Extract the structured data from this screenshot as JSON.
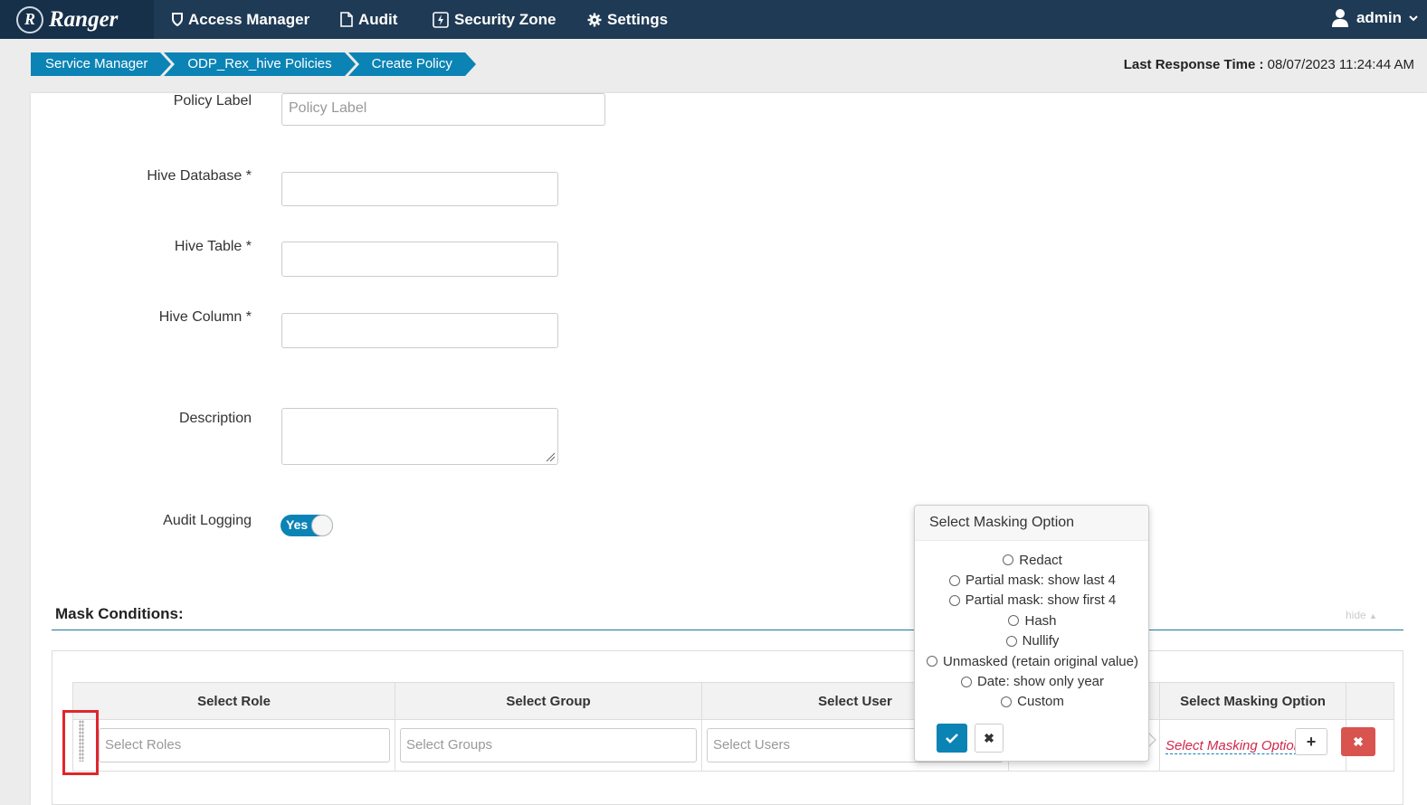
{
  "nav": {
    "brand": "Ranger",
    "brand_initial": "R",
    "access_manager": "Access Manager",
    "audit": "Audit",
    "security_zone": "Security Zone",
    "settings": "Settings",
    "user": "admin"
  },
  "breadcrumb": [
    "Service Manager",
    "ODP_Rex_hive Policies",
    "Create Policy"
  ],
  "last_response": {
    "label": "Last Response Time :",
    "value": "08/07/2023 11:24:44 AM"
  },
  "form": {
    "policy_label": {
      "label": "Policy Label",
      "placeholder": "Policy Label"
    },
    "hive_database": {
      "label": "Hive Database *",
      "value": ""
    },
    "hive_table": {
      "label": "Hive Table *",
      "value": ""
    },
    "hive_column": {
      "label": "Hive Column *",
      "value": ""
    },
    "description": {
      "label": "Description",
      "value": ""
    },
    "audit_logging": {
      "label": "Audit Logging",
      "value": "Yes"
    }
  },
  "mask_conditions": {
    "title": "Mask Conditions:",
    "hide_label": "hide",
    "columns": [
      "Select Role",
      "Select Group",
      "Select User",
      "Select Masking Option"
    ],
    "row": {
      "roles_placeholder": "Select Roles",
      "groups_placeholder": "Select Groups",
      "users_placeholder": "Select Users",
      "masking_link": "Select Masking Option"
    }
  },
  "popover": {
    "title": "Select Masking Option",
    "options": [
      "Redact",
      "Partial mask: show last 4",
      "Partial mask: show first 4",
      "Hash",
      "Nullify",
      "Unmasked (retain original value)",
      "Date: show only year",
      "Custom"
    ]
  },
  "colors": {
    "nav_bg": "#1f3a55",
    "accent": "#0b83b5",
    "danger": "#d9534f",
    "highlight": "#e0262c"
  }
}
